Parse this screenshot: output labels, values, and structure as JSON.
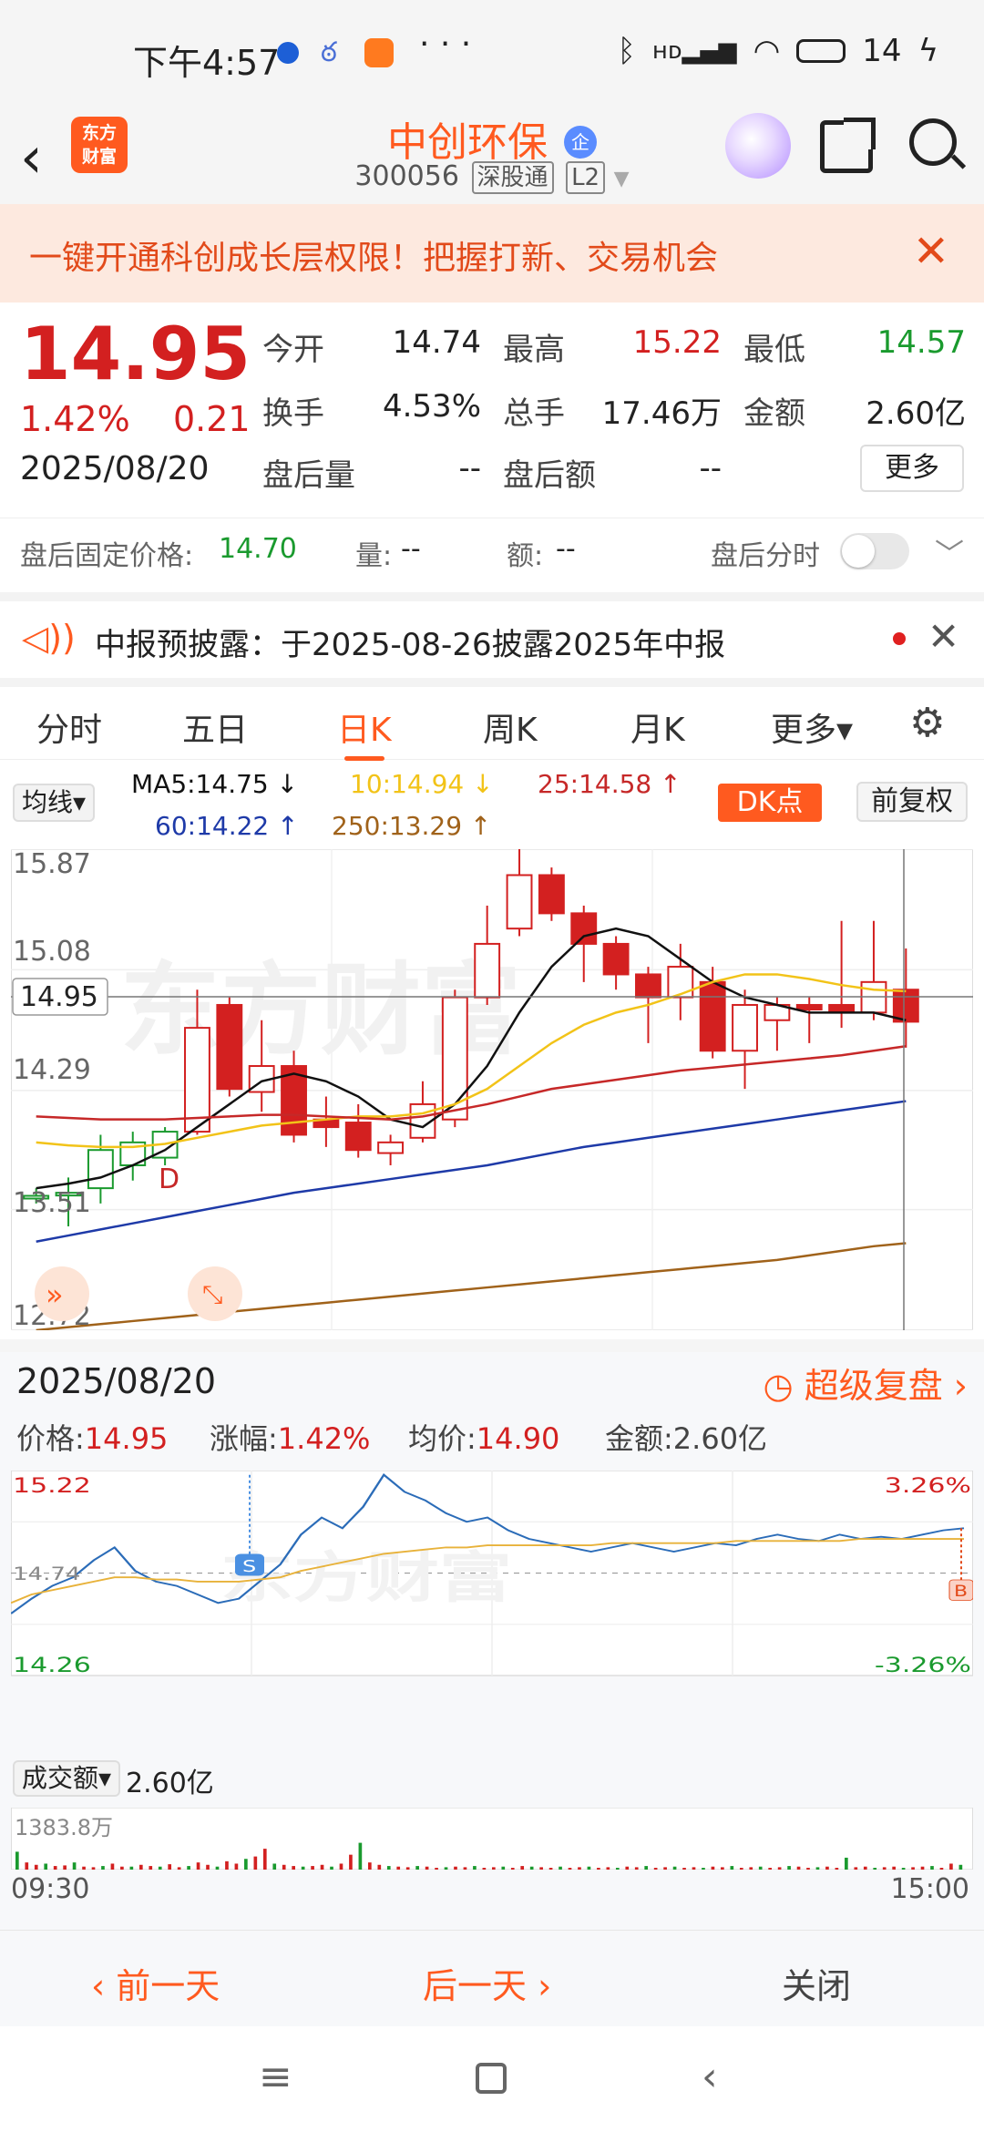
{
  "status_bar": {
    "time": "下午4:57",
    "icons_left": "· · ·",
    "battery": "14"
  },
  "header": {
    "stock_name": "中创环保",
    "qi_badge": "企",
    "code": "300056",
    "tag1": "深股通",
    "tag2": "L2",
    "logo_line1": "东方",
    "logo_line2": "财富"
  },
  "banner": {
    "text": "一键开通科创成长层权限！把握打新、交易机会",
    "close": "✕"
  },
  "quote": {
    "price": "14.95",
    "change_pct": "1.42%",
    "change_amt": "0.21",
    "date": "2025/08/20",
    "open_label": "今开",
    "open": "14.74",
    "high_label": "最高",
    "high": "15.22",
    "low_label": "最低",
    "low": "14.57",
    "turnover_label": "换手",
    "turnover": "4.53%",
    "volume_label": "总手",
    "volume": "17.46万",
    "amount_label": "金额",
    "amount": "2.60亿",
    "ah_vol_label": "盘后量",
    "ah_vol": "--",
    "ah_amt_label": "盘后额",
    "ah_amt": "--",
    "more": "更多"
  },
  "after_hours": {
    "fixed_label": "盘后固定价格:",
    "fixed_price": "14.70",
    "vol_label": "量:",
    "vol": "--",
    "amt_label": "额:",
    "amt": "--",
    "intraday_label": "盘后分时"
  },
  "notice": {
    "text": "中报预披露：于2025-08-26披露2025年中报"
  },
  "tabs": [
    "分时",
    "五日",
    "日K",
    "周K",
    "月K",
    "更多▾"
  ],
  "ma_legend": {
    "selector": "均线▾",
    "ma5": "MA5:14.75 ↓",
    "ma10": "10:14.94 ↓",
    "ma25": "25:14.58 ↑",
    "ma60": "60:14.22 ↑",
    "ma250": "250:13.29 ↑",
    "dk": "DK点",
    "fq": "前复权"
  },
  "kchart_axis": {
    "y1": "15.87",
    "y2": "15.08",
    "y3": "14.29",
    "y4": "13.51",
    "y5": "12.72",
    "current": "14.95",
    "marker": "D"
  },
  "colors": {
    "up": "#d32020",
    "down": "#1a9a2e",
    "ma5": "#111111",
    "ma10": "#f2c318",
    "ma25": "#c62828",
    "ma60": "#1e3aa8",
    "ma250": "#a0621a",
    "accent": "#ff5a1f"
  },
  "replay": {
    "date": "2025/08/20",
    "super": "超级复盘 ›",
    "price_label": "价格:",
    "price": "14.95",
    "chg_label": "涨幅:",
    "chg": "1.42%",
    "avg_label": "均价:",
    "avg": "14.90",
    "amt_label": "金额:",
    "amt": "2.60亿",
    "y_top": "15.22",
    "y_bottom": "14.26",
    "y_mid": "14.74",
    "pct_top": "3.26%",
    "pct_bottom": "-3.26%",
    "s_marker": "S",
    "b_marker": "B",
    "vol_selector": "成交额▾",
    "vol_value": "2.60亿",
    "vol_max": "1383.8万",
    "t_start": "09:30",
    "t_end": "15:00"
  },
  "actions": {
    "prev": "‹ 前一天",
    "next": "后一天 ›",
    "close": "关闭"
  },
  "chart_data": [
    {
      "type": "candlestick",
      "title": "",
      "ylim": [
        12.72,
        15.87
      ],
      "y_ticks": [
        15.87,
        15.08,
        14.29,
        13.51,
        12.72
      ],
      "candles": [
        {
          "o": 13.6,
          "c": 13.6,
          "h": 13.65,
          "l": 13.55
        },
        {
          "o": 13.62,
          "c": 13.62,
          "h": 13.72,
          "l": 13.4
        },
        {
          "o": 13.65,
          "c": 13.9,
          "h": 14.0,
          "l": 13.55
        },
        {
          "o": 13.8,
          "c": 13.95,
          "h": 14.02,
          "l": 13.7
        },
        {
          "o": 13.85,
          "c": 14.02,
          "h": 14.05,
          "l": 13.8
        },
        {
          "o": 14.02,
          "c": 14.7,
          "h": 14.95,
          "l": 14.0
        },
        {
          "o": 14.85,
          "c": 14.3,
          "h": 14.9,
          "l": 14.25
        },
        {
          "o": 14.28,
          "c": 14.45,
          "h": 14.75,
          "l": 14.15
        },
        {
          "o": 14.45,
          "c": 14.0,
          "h": 14.55,
          "l": 13.95
        },
        {
          "o": 14.1,
          "c": 14.05,
          "h": 14.25,
          "l": 13.92
        },
        {
          "o": 14.08,
          "c": 13.9,
          "h": 14.2,
          "l": 13.85
        },
        {
          "o": 13.88,
          "c": 13.95,
          "h": 14.0,
          "l": 13.8
        },
        {
          "o": 13.98,
          "c": 14.2,
          "h": 14.35,
          "l": 13.95
        },
        {
          "o": 14.1,
          "c": 14.9,
          "h": 14.95,
          "l": 14.05
        },
        {
          "o": 14.9,
          "c": 15.25,
          "h": 15.5,
          "l": 14.85
        },
        {
          "o": 15.35,
          "c": 15.7,
          "h": 15.87,
          "l": 15.3
        },
        {
          "o": 15.7,
          "c": 15.45,
          "h": 15.75,
          "l": 15.4
        },
        {
          "o": 15.45,
          "c": 15.25,
          "h": 15.5,
          "l": 15.0
        },
        {
          "o": 15.25,
          "c": 15.05,
          "h": 15.3,
          "l": 14.95
        },
        {
          "o": 15.05,
          "c": 14.9,
          "h": 15.1,
          "l": 14.6
        },
        {
          "o": 14.9,
          "c": 15.1,
          "h": 15.25,
          "l": 14.75
        },
        {
          "o": 15.0,
          "c": 14.55,
          "h": 15.1,
          "l": 14.5
        },
        {
          "o": 14.55,
          "c": 14.85,
          "h": 14.95,
          "l": 14.3
        },
        {
          "o": 14.75,
          "c": 14.85,
          "h": 14.9,
          "l": 14.55
        },
        {
          "o": 14.85,
          "c": 14.82,
          "h": 14.9,
          "l": 14.6
        },
        {
          "o": 14.85,
          "c": 14.8,
          "h": 15.4,
          "l": 14.7
        },
        {
          "o": 14.8,
          "c": 15.0,
          "h": 15.4,
          "l": 14.75
        },
        {
          "o": 14.95,
          "c": 14.74,
          "h": 15.22,
          "l": 14.57
        }
      ],
      "ma5": [
        13.65,
        13.68,
        13.72,
        13.8,
        13.9,
        14.05,
        14.2,
        14.35,
        14.4,
        14.35,
        14.25,
        14.1,
        14.05,
        14.2,
        14.45,
        14.8,
        15.1,
        15.3,
        15.35,
        15.3,
        15.15,
        15.0,
        14.9,
        14.85,
        14.8,
        14.8,
        14.8,
        14.75
      ],
      "ma10": [
        13.95,
        13.93,
        13.92,
        13.92,
        13.94,
        13.98,
        14.02,
        14.06,
        14.08,
        14.1,
        14.12,
        14.12,
        14.14,
        14.2,
        14.3,
        14.45,
        14.6,
        14.72,
        14.8,
        14.85,
        14.92,
        15.0,
        15.05,
        15.05,
        15.02,
        14.98,
        14.95,
        14.94
      ],
      "ma25": [
        14.12,
        14.11,
        14.1,
        14.1,
        14.1,
        14.11,
        14.12,
        14.13,
        14.13,
        14.12,
        14.11,
        14.1,
        14.12,
        14.16,
        14.2,
        14.25,
        14.3,
        14.33,
        14.36,
        14.39,
        14.42,
        14.44,
        14.46,
        14.48,
        14.5,
        14.52,
        14.55,
        14.58
      ],
      "ma60": [
        13.3,
        13.34,
        13.38,
        13.42,
        13.46,
        13.5,
        13.54,
        13.58,
        13.62,
        13.65,
        13.68,
        13.71,
        13.74,
        13.77,
        13.8,
        13.84,
        13.88,
        13.92,
        13.95,
        13.98,
        14.01,
        14.04,
        14.07,
        14.1,
        14.13,
        14.16,
        14.19,
        14.22
      ],
      "ma250": [
        12.72,
        12.74,
        12.76,
        12.78,
        12.8,
        12.82,
        12.84,
        12.86,
        12.88,
        12.9,
        12.92,
        12.94,
        12.96,
        12.98,
        13.0,
        13.02,
        13.04,
        13.06,
        13.08,
        13.1,
        13.12,
        13.14,
        13.16,
        13.18,
        13.21,
        13.24,
        13.27,
        13.29
      ]
    },
    {
      "type": "line",
      "title": "",
      "x": [
        "09:30",
        "15:00"
      ],
      "ylim": [
        14.26,
        15.22
      ],
      "series": [
        {
          "name": "价格",
          "values": [
            14.55,
            14.62,
            14.68,
            14.72,
            14.8,
            14.86,
            14.75,
            14.7,
            14.68,
            14.64,
            14.6,
            14.62,
            14.7,
            14.78,
            14.92,
            15.0,
            14.95,
            15.05,
            15.2,
            15.12,
            15.08,
            15.02,
            14.98,
            15.0,
            14.94,
            14.9,
            14.88,
            14.86,
            14.84,
            14.86,
            14.88,
            14.86,
            14.84,
            14.86,
            14.88,
            14.87,
            14.9,
            14.92,
            14.9,
            14.89,
            14.92,
            14.9,
            14.91,
            14.9,
            14.92,
            14.94,
            14.95
          ]
        },
        {
          "name": "均价",
          "values": [
            14.6,
            14.64,
            14.66,
            14.68,
            14.7,
            14.72,
            14.72,
            14.71,
            14.71,
            14.7,
            14.7,
            14.7,
            14.71,
            14.72,
            14.75,
            14.77,
            14.79,
            14.81,
            14.83,
            14.84,
            14.85,
            14.86,
            14.86,
            14.87,
            14.87,
            14.87,
            14.87,
            14.87,
            14.87,
            14.88,
            14.88,
            14.88,
            14.88,
            14.88,
            14.88,
            14.89,
            14.89,
            14.89,
            14.89,
            14.89,
            14.89,
            14.9,
            14.9,
            14.9,
            14.9,
            14.9,
            14.9
          ]
        }
      ],
      "volume_max_label": "1383.8万",
      "volume": [
        0.3,
        0.12,
        0.08,
        0.1,
        0.06,
        0.07,
        0.12,
        0.05,
        0.04,
        0.06,
        0.1,
        0.05,
        0.05,
        0.08,
        0.06,
        0.05,
        0.09,
        0.04,
        0.06,
        0.12,
        0.08,
        0.05,
        0.14,
        0.1,
        0.18,
        0.22,
        0.35,
        0.1,
        0.08,
        0.06,
        0.05,
        0.06,
        0.08,
        0.05,
        0.1,
        0.25,
        0.45,
        0.12,
        0.08,
        0.06,
        0.05,
        0.04,
        0.06,
        0.05,
        0.03,
        0.04,
        0.05,
        0.04,
        0.06,
        0.03,
        0.04,
        0.05,
        0.03,
        0.06,
        0.05,
        0.04,
        0.03,
        0.05,
        0.03,
        0.04,
        0.05,
        0.03,
        0.04,
        0.03,
        0.05,
        0.04,
        0.06,
        0.03,
        0.04,
        0.05,
        0.03,
        0.04,
        0.03,
        0.05,
        0.04,
        0.06,
        0.03,
        0.04,
        0.05,
        0.03,
        0.04,
        0.06,
        0.05,
        0.03,
        0.04,
        0.05,
        0.03,
        0.2,
        0.04,
        0.05,
        0.03,
        0.04,
        0.05,
        0.03,
        0.04,
        0.05,
        0.06,
        0.03,
        0.1,
        0.08
      ]
    }
  ]
}
